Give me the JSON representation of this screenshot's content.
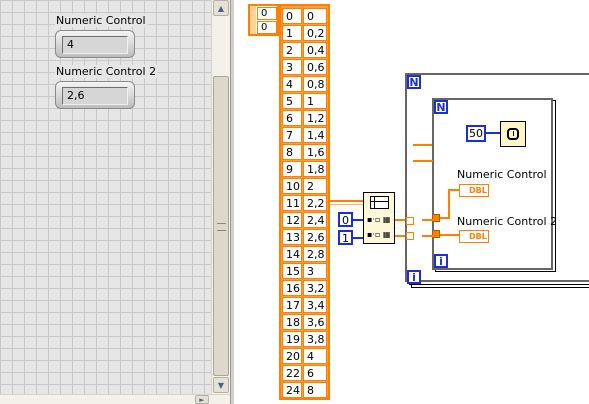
{
  "front_panel": {
    "controls": [
      {
        "label": "Numeric Control",
        "value": "4"
      },
      {
        "label": "Numeric Control 2",
        "value": "2,6"
      }
    ]
  },
  "block_diagram": {
    "index_controls": [
      "0",
      "0"
    ],
    "array_rows": [
      [
        "0",
        "0"
      ],
      [
        "1",
        "0,2"
      ],
      [
        "2",
        "0,4"
      ],
      [
        "3",
        "0,6"
      ],
      [
        "4",
        "0,8"
      ],
      [
        "5",
        "1"
      ],
      [
        "6",
        "1,2"
      ],
      [
        "7",
        "1,4"
      ],
      [
        "8",
        "1,6"
      ],
      [
        "9",
        "1,8"
      ],
      [
        "10",
        "2"
      ],
      [
        "11",
        "2,2"
      ],
      [
        "12",
        "2,4"
      ],
      [
        "13",
        "2,6"
      ],
      [
        "14",
        "2,8"
      ],
      [
        "15",
        "3"
      ],
      [
        "16",
        "3,2"
      ],
      [
        "17",
        "3,4"
      ],
      [
        "18",
        "3,6"
      ],
      [
        "19",
        "3,8"
      ],
      [
        "20",
        "4"
      ],
      [
        "22",
        "6"
      ],
      [
        "24",
        "8"
      ]
    ],
    "index_constants": [
      "0",
      "1"
    ],
    "outer_loop_N": "N",
    "outer_loop_i": "i",
    "inner_loop_N": "N",
    "inner_loop_i": "i",
    "wait_constant": "50",
    "indicator_terminals": [
      {
        "label": "Numeric Control",
        "type": "DBL"
      },
      {
        "label": "Numeric Control 2",
        "type": "DBL"
      }
    ]
  },
  "colors": {
    "wire_orange": "#ff7f00",
    "loop_blue": "#1c2fd6"
  },
  "icons": [
    "scroll-up-arrow-icon",
    "scroll-down-arrow-icon",
    "scroll-grip-icon",
    "wait-timer-icon",
    "index-array-icon"
  ]
}
